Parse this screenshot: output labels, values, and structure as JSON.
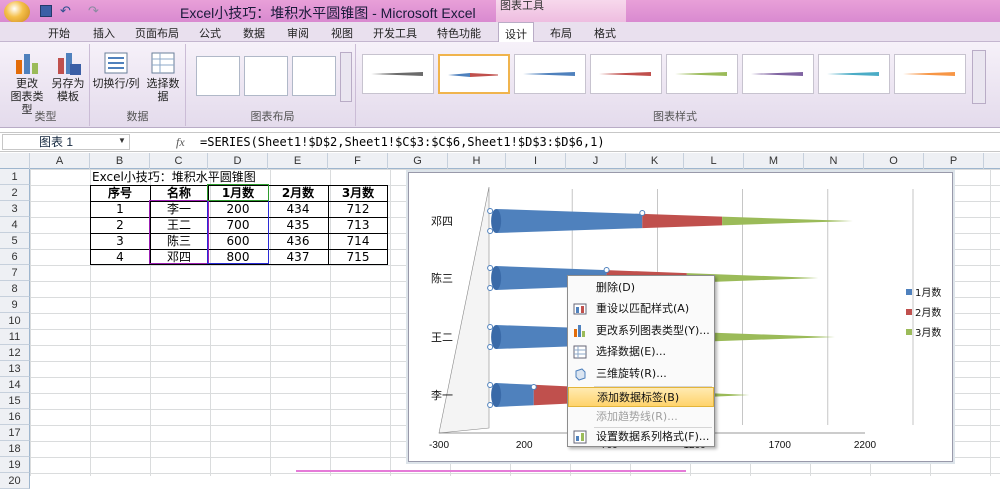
{
  "window": {
    "title": "Excel小技巧：堆积水平圆锥图 - Microsoft Excel",
    "context_tab_group": "图表工具"
  },
  "tabs": [
    "开始",
    "插入",
    "页面布局",
    "公式",
    "数据",
    "审阅",
    "视图",
    "开发工具",
    "特色功能",
    "设计",
    "布局",
    "格式"
  ],
  "ribbon": {
    "groups": {
      "type": "类型",
      "data": "数据",
      "layout": "图表布局",
      "styles": "图表样式"
    },
    "buttons": {
      "change_type": "更改\n图表类型",
      "save_template": "另存为\n模板",
      "switch_rowcol": "切换行/列",
      "select_data": "选择数据"
    }
  },
  "formula": {
    "name_box": "图表 1",
    "fx": "fx",
    "value": "=SERIES(Sheet1!$D$2,Sheet1!$C$3:$C$6,Sheet1!$D$3:$D$6,1)"
  },
  "columns": [
    "A",
    "B",
    "C",
    "D",
    "E",
    "F",
    "G",
    "H",
    "I",
    "J",
    "K",
    "L",
    "M",
    "N",
    "O",
    "P"
  ],
  "rows": [
    "1",
    "2",
    "3",
    "4",
    "5",
    "6",
    "7",
    "8",
    "9",
    "10",
    "11",
    "12",
    "13",
    "14",
    "15",
    "16",
    "17",
    "18",
    "19",
    "20"
  ],
  "sheet": {
    "title": "Excel小技巧：堆积水平圆锥图",
    "headers": [
      "序号",
      "名称",
      "1月数",
      "2月数",
      "3月数"
    ],
    "data": [
      [
        "1",
        "李一",
        "200",
        "434",
        "712"
      ],
      [
        "2",
        "王二",
        "700",
        "435",
        "713"
      ],
      [
        "3",
        "陈三",
        "600",
        "436",
        "714"
      ],
      [
        "4",
        "邓四",
        "800",
        "437",
        "715"
      ]
    ]
  },
  "chart_data": {
    "type": "bar",
    "orientation": "horizontal",
    "stacked": true,
    "shape": "cone",
    "categories": [
      "李一",
      "王二",
      "陈三",
      "邓四"
    ],
    "series": [
      {
        "name": "1月数",
        "values": [
          200,
          700,
          600,
          800
        ],
        "color": "#4f81bd"
      },
      {
        "name": "2月数",
        "values": [
          434,
          435,
          436,
          437
        ],
        "color": "#c0504d"
      },
      {
        "name": "3月数",
        "values": [
          712,
          713,
          714,
          715
        ],
        "color": "#9bbb59"
      }
    ],
    "x_ticks": [
      "-300",
      "200",
      "700",
      "1200",
      "1700",
      "2200"
    ],
    "legend_position": "right"
  },
  "context_menu": {
    "items": [
      {
        "label": "删除(D)",
        "icon": "none",
        "enabled": true,
        "highlighted": false
      },
      {
        "label": "重设以匹配样式(A)",
        "icon": "reset-style-icon",
        "enabled": true,
        "highlighted": false
      },
      {
        "label": "更改系列图表类型(Y)...",
        "icon": "chart-type-icon",
        "enabled": true,
        "highlighted": false
      },
      {
        "label": "选择数据(E)...",
        "icon": "select-data-icon",
        "enabled": true,
        "highlighted": false
      },
      {
        "label": "三维旋转(R)...",
        "icon": "rotate-3d-icon",
        "enabled": true,
        "highlighted": false
      },
      {
        "label": "添加数据标签(B)",
        "icon": "none",
        "enabled": true,
        "highlighted": true
      },
      {
        "label": "添加趋势线(R)...",
        "icon": "none",
        "enabled": false,
        "highlighted": false
      },
      {
        "label": "设置数据系列格式(F)...",
        "icon": "format-series-icon",
        "enabled": true,
        "highlighted": false
      }
    ]
  }
}
